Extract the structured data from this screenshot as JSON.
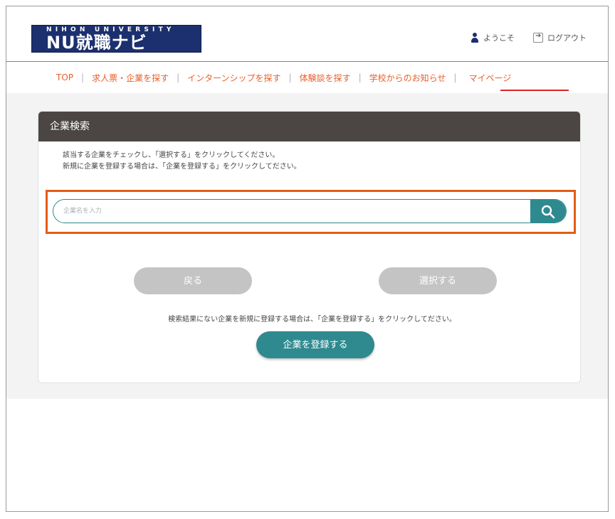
{
  "header": {
    "logo_sub": "NIHON UNIVERSITY",
    "logo_main": "NU就職ナビ",
    "welcome_label": "ようこそ",
    "logout_label": "ログアウト"
  },
  "nav": {
    "items": [
      {
        "label": "TOP"
      },
      {
        "label": "求人票・企業を探す"
      },
      {
        "label": "インターンシップを探す"
      },
      {
        "label": "体験談を探す"
      },
      {
        "label": "学校からのお知らせ"
      },
      {
        "label": "マイページ"
      }
    ],
    "separator": "|",
    "active": "マイページ"
  },
  "card": {
    "title": "企業検索",
    "instructions": [
      "該当する企業をチェックし、「選択する」をクリックしてください。",
      "新規に企業を登録する場合は、「企業を登録する」をクリックしてださい。"
    ]
  },
  "search": {
    "placeholder": "企業名を入力",
    "icon": "search-icon"
  },
  "buttons": {
    "back": "戻る",
    "select": "選択する",
    "register": "企業を登録する"
  },
  "note": "検索結果にない企業を新規に登録する場合は、「企業を登録する」をクリックしてださい。",
  "colors": {
    "accent": "#e8602c",
    "teal": "#2f8a8f",
    "header_dark": "#4b4643",
    "logo_navy": "#1c2f6e",
    "highlight": "#e25d16"
  }
}
